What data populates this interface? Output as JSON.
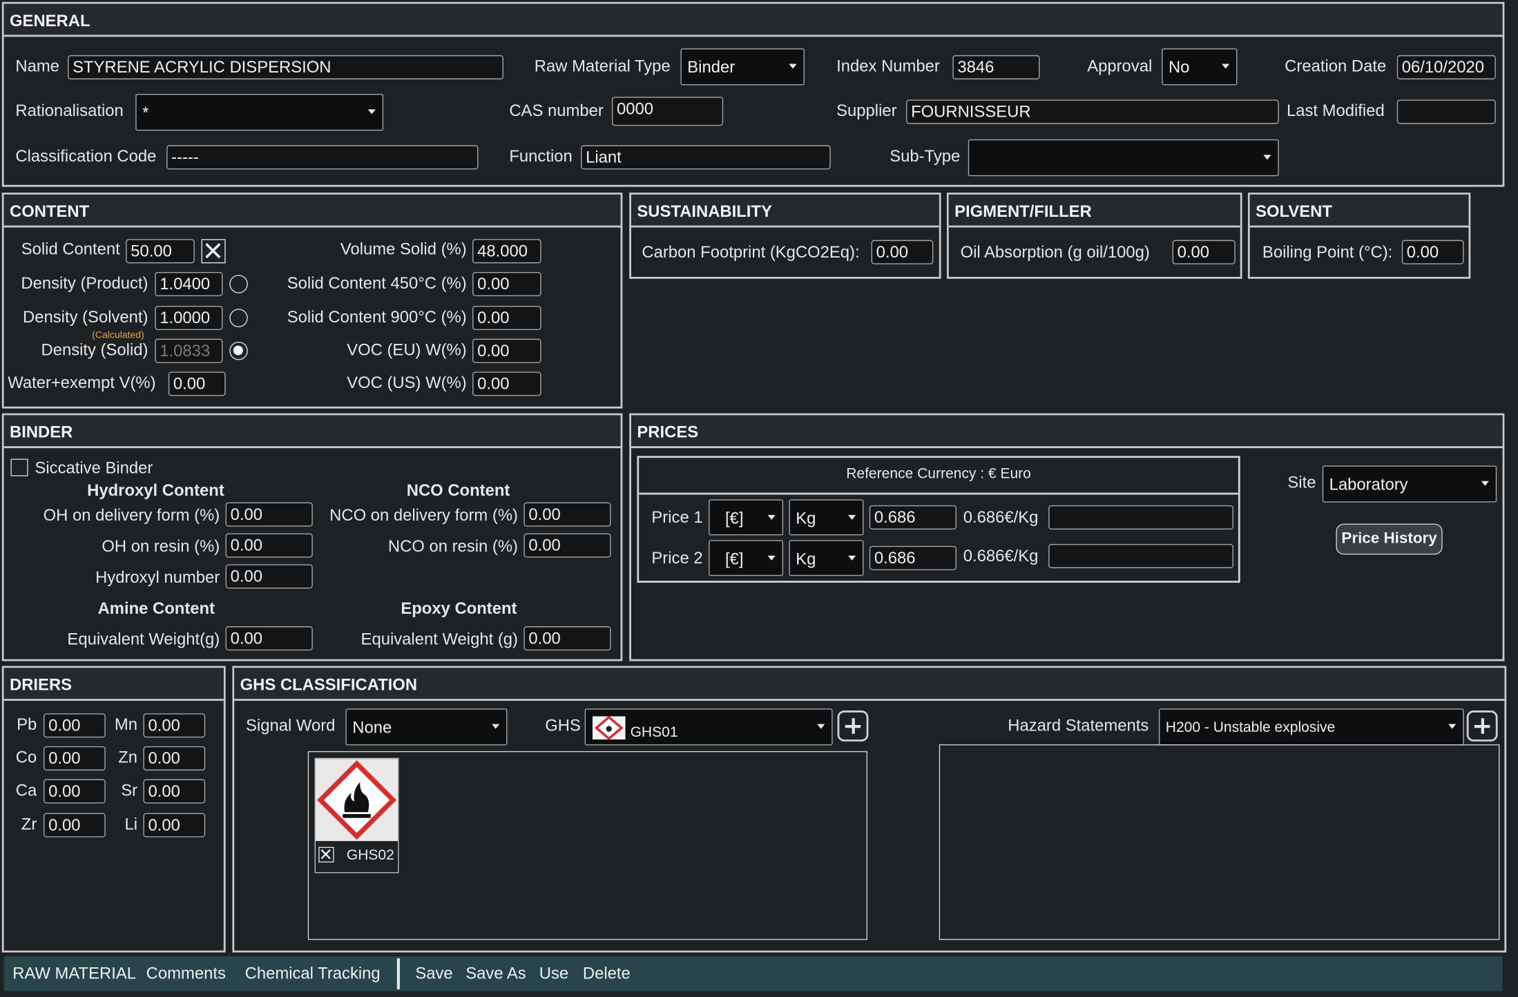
{
  "general": {
    "title": "GENERAL",
    "name_label": "Name",
    "name_value": "STYRENE ACRYLIC DISPERSION",
    "raw_type_label": "Raw Material Type",
    "raw_type_value": "Binder",
    "index_label": "Index Number",
    "index_value": "3846",
    "approval_label": "Approval",
    "approval_value": "No",
    "creation_label": "Creation Date",
    "creation_value": "06/10/2020",
    "rational_label": "Rationalisation",
    "rational_value": "*",
    "cas_label": "CAS number",
    "cas_value": "0000",
    "supplier_label": "Supplier",
    "supplier_value": "FOURNISSEUR",
    "lastmod_label": "Last Modified",
    "lastmod_value": "",
    "class_label": "Classification Code",
    "class_value": "-----",
    "function_label": "Function",
    "function_value": "Liant",
    "subtype_label": "Sub-Type",
    "subtype_value": ""
  },
  "content": {
    "title": "CONTENT",
    "solid_label": "Solid Content",
    "solid_value": "50.00",
    "dprod_label": "Density (Product)",
    "dprod_value": "1.0400",
    "dsolv_label": "Density (Solvent)",
    "dsolv_value": "1.0000",
    "calc_note": "(Calculated)",
    "dsolid_label": "Density (Solid)",
    "dsolid_value": "1.0833",
    "water_label": "Water+exempt V(%)",
    "water_value": "0.00",
    "vsolid_label": "Volume Solid (%)",
    "vsolid_value": "48.000",
    "sc450_label": "Solid Content 450°C (%)",
    "sc450_value": "0.00",
    "sc900_label": "Solid Content 900°C (%)",
    "sc900_value": "0.00",
    "voceu_label": "VOC (EU) W(%)",
    "voceu_value": "0.00",
    "vocus_label": "VOC (US) W(%)",
    "vocus_value": "0.00"
  },
  "sustainability": {
    "title": "SUSTAINABILITY",
    "label": "Carbon Footprint (KgCO2Eq):",
    "value": "0.00"
  },
  "pigment": {
    "title": "PIGMENT/FILLER",
    "label": "Oil Absorption (g oil/100g)",
    "value": "0.00"
  },
  "solvent": {
    "title": "SOLVENT",
    "label": "Boiling Point (°C):",
    "value": "0.00"
  },
  "binder": {
    "title": "BINDER",
    "siccative_label": "Siccative Binder",
    "hydroxyl_title": "Hydroxyl Content",
    "nco_title": "NCO Content",
    "oh_delivery_label": "OH on delivery form (%)",
    "oh_delivery_value": "0.00",
    "oh_resin_label": "OH on resin (%)",
    "oh_resin_value": "0.00",
    "hydroxyl_label": "Hydroxyl number",
    "hydroxyl_value": "0.00",
    "nco_delivery_label": "NCO on delivery form (%)",
    "nco_delivery_value": "0.00",
    "nco_resin_label": "NCO on resin (%)",
    "nco_resin_value": "0.00",
    "amine_title": "Amine Content",
    "epoxy_title": "Epoxy Content",
    "amine_label": "Equivalent Weight(g)",
    "amine_value": "0.00",
    "epoxy_label": "Equivalent Weight (g)",
    "epoxy_value": "0.00"
  },
  "prices": {
    "title": "PRICES",
    "ref_currency": "Reference Currency : €  Euro",
    "site_label": "Site",
    "site_value": "Laboratory",
    "history_button": "Price History",
    "rows": [
      {
        "label": "Price 1",
        "currency": "[€]",
        "unit": "Kg",
        "value": "0.686",
        "display": "0.686€/Kg",
        "extra": ""
      },
      {
        "label": "Price 2",
        "currency": "[€]",
        "unit": "Kg",
        "value": "0.686",
        "display": "0.686€/Kg",
        "extra": ""
      }
    ]
  },
  "driers": {
    "title": "DRIERS",
    "items": [
      {
        "label": "Pb",
        "value": "0.00"
      },
      {
        "label": "Mn",
        "value": "0.00"
      },
      {
        "label": "Co",
        "value": "0.00"
      },
      {
        "label": "Zn",
        "value": "0.00"
      },
      {
        "label": "Ca",
        "value": "0.00"
      },
      {
        "label": "Sr",
        "value": "0.00"
      },
      {
        "label": "Zr",
        "value": "0.00"
      },
      {
        "label": "Li",
        "value": "0.00"
      }
    ]
  },
  "ghs": {
    "title": "GHS CLASSIFICATION",
    "signal_label": "Signal Word",
    "signal_value": "None",
    "ghs_label": "GHS",
    "ghs_value": "GHS01",
    "hazard_label": "Hazard Statements",
    "hazard_value": "H200 - Unstable explosive",
    "pictogram_code": "GHS02",
    "pictogram_icon": "flame-pictogram-icon",
    "accent_red": "#d32f2f"
  },
  "footer": {
    "tabs": [
      "RAW MATERIAL",
      "Comments",
      "Chemical Tracking"
    ],
    "actions": [
      "Save",
      "Save As",
      "Use",
      "Delete"
    ]
  }
}
